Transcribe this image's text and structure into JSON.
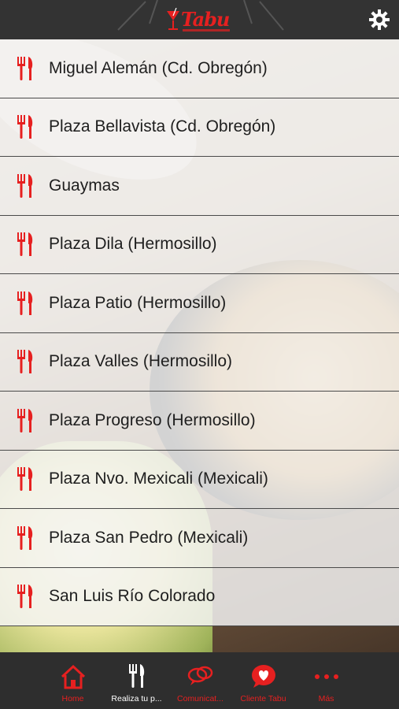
{
  "header": {
    "logo_text": "Tabu",
    "settings_icon": "gear-icon"
  },
  "colors": {
    "accent": "#e62020",
    "bar": "#333333",
    "row_bg": "#f4f4f4"
  },
  "branches": [
    {
      "label": "Miguel Alemán (Cd. Obregón)",
      "icon": "fork-knife-icon"
    },
    {
      "label": "Plaza Bellavista (Cd. Obregón)",
      "icon": "fork-knife-icon"
    },
    {
      "label": "Guaymas",
      "icon": "fork-knife-icon"
    },
    {
      "label": "Plaza Dila (Hermosillo)",
      "icon": "fork-knife-icon"
    },
    {
      "label": "Plaza Patio (Hermosillo)",
      "icon": "fork-knife-icon"
    },
    {
      "label": "Plaza Valles (Hermosillo)",
      "icon": "fork-knife-icon"
    },
    {
      "label": "Plaza Progreso (Hermosillo)",
      "icon": "fork-knife-icon"
    },
    {
      "label": "Plaza Nvo. Mexicali (Mexicali)",
      "icon": "fork-knife-icon"
    },
    {
      "label": "Plaza San Pedro (Mexicali)",
      "icon": "fork-knife-icon"
    },
    {
      "label": "San Luis Río Colorado",
      "icon": "fork-knife-icon"
    }
  ],
  "tabbar": {
    "tabs": [
      {
        "label": "Home",
        "icon": "home-icon"
      },
      {
        "label": "Realiza tu p...",
        "icon": "fork-knife-icon",
        "active": true
      },
      {
        "label": "Comunicat...",
        "icon": "chat-bubbles-icon"
      },
      {
        "label": "Cliente Tabu",
        "icon": "heart-bubble-icon"
      },
      {
        "label": "Más",
        "icon": "more-dots-icon"
      }
    ]
  }
}
